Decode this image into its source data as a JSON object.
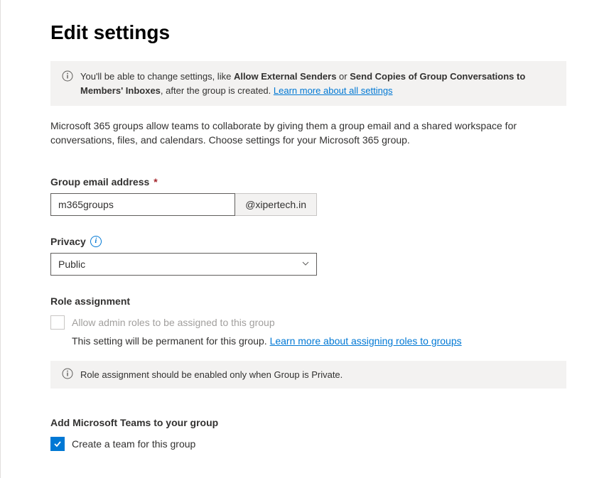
{
  "header": {
    "title": "Edit settings"
  },
  "infoBanner": {
    "prefix": "You'll be able to change settings, like ",
    "bold1": "Allow External Senders",
    "mid": " or ",
    "bold2": "Send Copies of Group Conversations to Members' Inboxes",
    "suffix": ", after the group is created. ",
    "linkText": "Learn more about all settings"
  },
  "description": "Microsoft 365 groups allow teams to collaborate by giving them a group email and a shared workspace for conversations, files, and calendars. Choose settings for your Microsoft 365 group.",
  "emailField": {
    "label": "Group email address",
    "required": "*",
    "value": "m365groups",
    "domain": "@xipertech.in"
  },
  "privacyField": {
    "label": "Privacy",
    "value": "Public"
  },
  "roleAssignment": {
    "heading": "Role assignment",
    "checkboxLabel": "Allow admin roles to be assigned to this group",
    "helpText": "This setting will be permanent for this group. ",
    "linkText": "Learn more about assigning roles to groups",
    "infoNote": "Role assignment should be enabled only when Group is Private."
  },
  "teamsSection": {
    "heading": "Add Microsoft Teams to your group",
    "checkboxLabel": "Create a team for this group"
  }
}
